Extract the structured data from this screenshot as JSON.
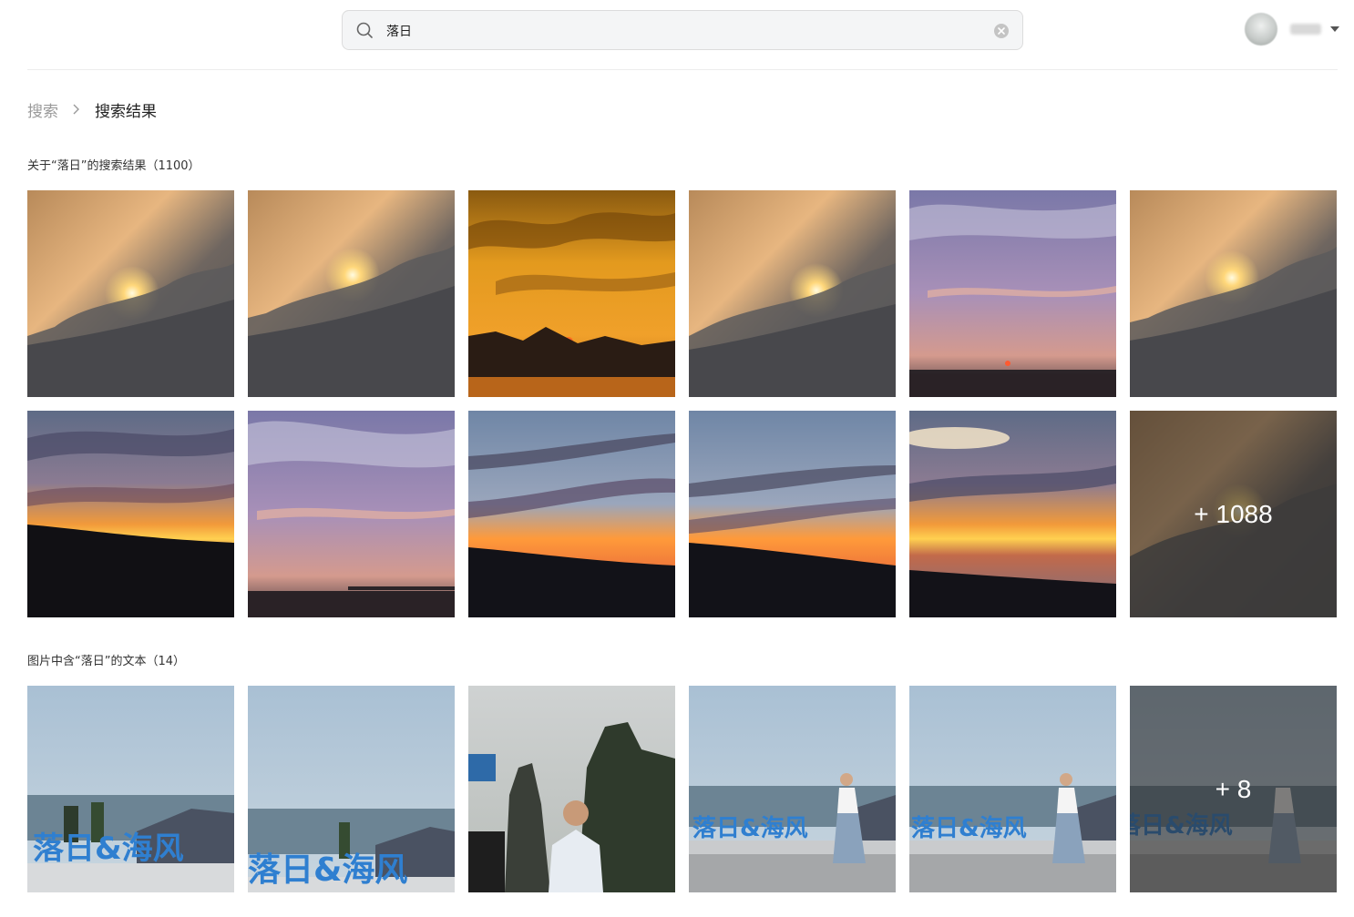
{
  "search": {
    "value": "落日",
    "placeholder": ""
  },
  "user": {
    "name": "····"
  },
  "breadcrumb": {
    "root": "搜索",
    "current": "搜索结果"
  },
  "section_results": {
    "title": "关于“落日”的搜索结果（1100）",
    "more_label": "+ 1088",
    "thumbs": [
      "sunset-clouds-photo",
      "sunset-clouds-photo",
      "golden-sunset-mountains-photo",
      "sunset-clouds-photo",
      "purple-dusk-sea-photo",
      "sunset-clouds-photo",
      "sunset-horizon-photo",
      "purple-dusk-sea-photo",
      "sunset-streaks-photo",
      "sunset-streaks-photo",
      "sunset-horizon-photo",
      "more-results-photo"
    ]
  },
  "section_text": {
    "title": "图片中含“落日”的文本（14）",
    "more_label": "+ 8",
    "sign_text": "落日&海风",
    "thumbs": [
      "seaside-sign-photo",
      "seaside-sign-photo",
      "man-mountain-photo",
      "woman-seaside-sign-photo",
      "woman-seaside-sign-photo",
      "more-results-photo"
    ]
  },
  "colors": {
    "accent_sign": "#2f7fd0",
    "divider": "#ececec",
    "breadcrumb_root": "#9a9a9a"
  }
}
